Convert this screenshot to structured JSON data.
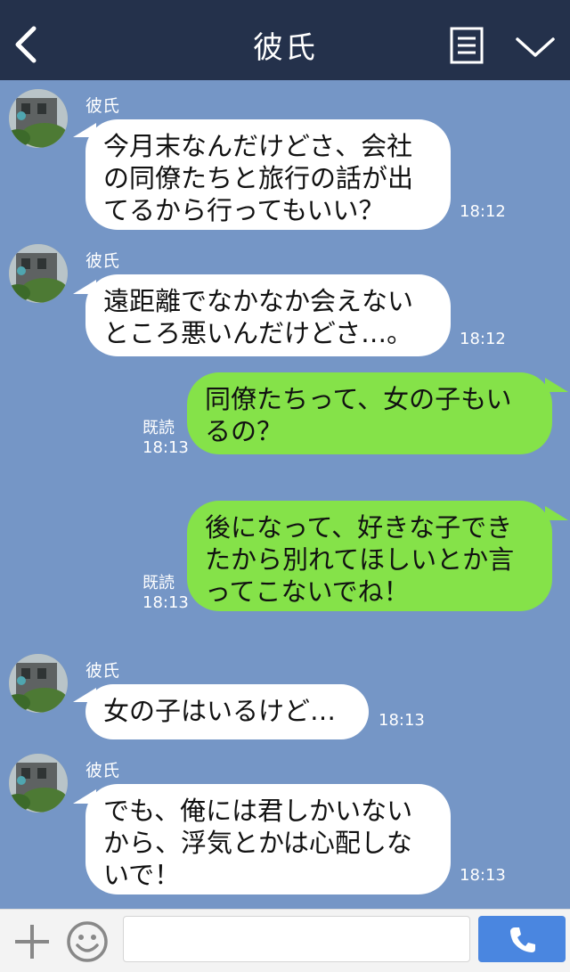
{
  "header": {
    "title": "彼氏"
  },
  "messages": [
    {
      "sender": "彼氏",
      "text": "今月末なんだけどさ、会社\nの同僚たちと旅行の話が出\nてるから行ってもいい？",
      "time": "18:12"
    },
    {
      "sender": "彼氏",
      "text": "遠距離でなかなか会えない\nところ悪いんだけどさ…。",
      "time": "18:12"
    },
    {
      "sender": "me",
      "text": "同僚たちって、女の子もい\nるの？",
      "read": "既読",
      "time": "18:13"
    },
    {
      "sender": "me",
      "text": "後になって、好きな子でき\nたから別れてほしいとか言\nってこないでね！",
      "read": "既読",
      "time": "18:13"
    },
    {
      "sender": "彼氏",
      "text": "女の子はいるけど…",
      "time": "18:13"
    },
    {
      "sender": "彼氏",
      "text": "でも、俺には君しかいない\nから、浮気とかは心配しな\nいで！",
      "time": "18:13"
    }
  ],
  "footer": {
    "input_placeholder": ""
  },
  "colors": {
    "header_bg": "#24314b",
    "chat_bg": "#7596c6",
    "incoming_bubble": "#ffffff",
    "outgoing_bubble": "#85e249",
    "call_button": "#4a86e0"
  },
  "icons": {
    "back": "back-chevron-icon",
    "menu": "menu-list-icon",
    "collapse": "chevron-down-icon",
    "plus": "plus-icon",
    "emoji": "emoji-icon",
    "call": "phone-icon"
  }
}
